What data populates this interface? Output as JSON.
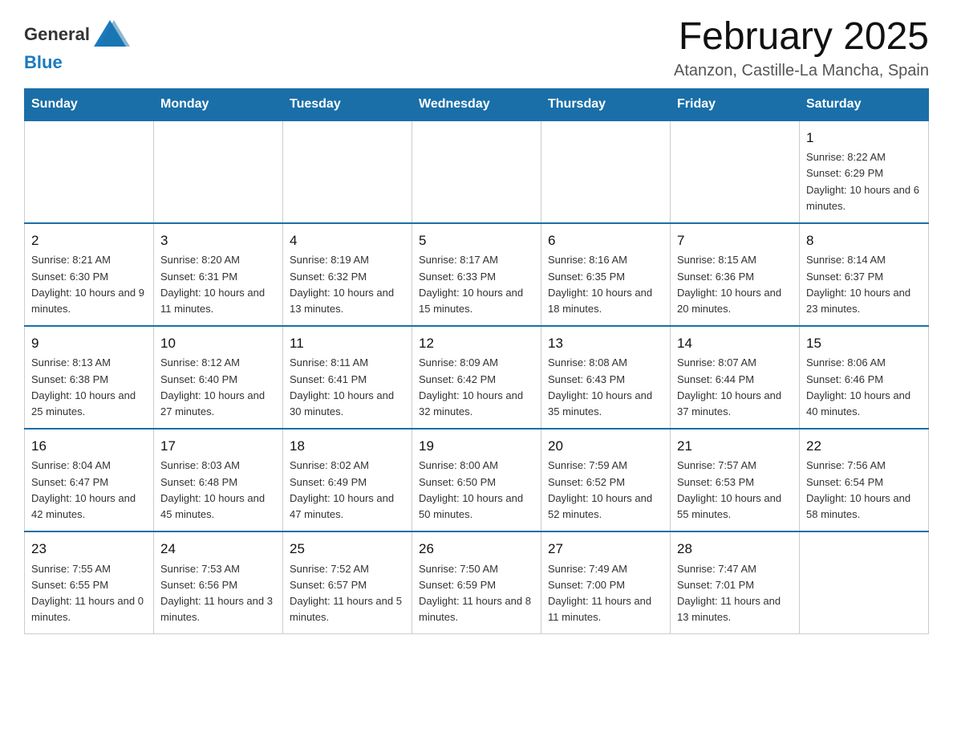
{
  "header": {
    "logo_general": "General",
    "logo_blue": "Blue",
    "month_title": "February 2025",
    "location": "Atanzon, Castille-La Mancha, Spain"
  },
  "weekdays": [
    "Sunday",
    "Monday",
    "Tuesday",
    "Wednesday",
    "Thursday",
    "Friday",
    "Saturday"
  ],
  "weeks": [
    [
      {
        "day": "",
        "info": ""
      },
      {
        "day": "",
        "info": ""
      },
      {
        "day": "",
        "info": ""
      },
      {
        "day": "",
        "info": ""
      },
      {
        "day": "",
        "info": ""
      },
      {
        "day": "",
        "info": ""
      },
      {
        "day": "1",
        "info": "Sunrise: 8:22 AM\nSunset: 6:29 PM\nDaylight: 10 hours and 6 minutes."
      }
    ],
    [
      {
        "day": "2",
        "info": "Sunrise: 8:21 AM\nSunset: 6:30 PM\nDaylight: 10 hours and 9 minutes."
      },
      {
        "day": "3",
        "info": "Sunrise: 8:20 AM\nSunset: 6:31 PM\nDaylight: 10 hours and 11 minutes."
      },
      {
        "day": "4",
        "info": "Sunrise: 8:19 AM\nSunset: 6:32 PM\nDaylight: 10 hours and 13 minutes."
      },
      {
        "day": "5",
        "info": "Sunrise: 8:17 AM\nSunset: 6:33 PM\nDaylight: 10 hours and 15 minutes."
      },
      {
        "day": "6",
        "info": "Sunrise: 8:16 AM\nSunset: 6:35 PM\nDaylight: 10 hours and 18 minutes."
      },
      {
        "day": "7",
        "info": "Sunrise: 8:15 AM\nSunset: 6:36 PM\nDaylight: 10 hours and 20 minutes."
      },
      {
        "day": "8",
        "info": "Sunrise: 8:14 AM\nSunset: 6:37 PM\nDaylight: 10 hours and 23 minutes."
      }
    ],
    [
      {
        "day": "9",
        "info": "Sunrise: 8:13 AM\nSunset: 6:38 PM\nDaylight: 10 hours and 25 minutes."
      },
      {
        "day": "10",
        "info": "Sunrise: 8:12 AM\nSunset: 6:40 PM\nDaylight: 10 hours and 27 minutes."
      },
      {
        "day": "11",
        "info": "Sunrise: 8:11 AM\nSunset: 6:41 PM\nDaylight: 10 hours and 30 minutes."
      },
      {
        "day": "12",
        "info": "Sunrise: 8:09 AM\nSunset: 6:42 PM\nDaylight: 10 hours and 32 minutes."
      },
      {
        "day": "13",
        "info": "Sunrise: 8:08 AM\nSunset: 6:43 PM\nDaylight: 10 hours and 35 minutes."
      },
      {
        "day": "14",
        "info": "Sunrise: 8:07 AM\nSunset: 6:44 PM\nDaylight: 10 hours and 37 minutes."
      },
      {
        "day": "15",
        "info": "Sunrise: 8:06 AM\nSunset: 6:46 PM\nDaylight: 10 hours and 40 minutes."
      }
    ],
    [
      {
        "day": "16",
        "info": "Sunrise: 8:04 AM\nSunset: 6:47 PM\nDaylight: 10 hours and 42 minutes."
      },
      {
        "day": "17",
        "info": "Sunrise: 8:03 AM\nSunset: 6:48 PM\nDaylight: 10 hours and 45 minutes."
      },
      {
        "day": "18",
        "info": "Sunrise: 8:02 AM\nSunset: 6:49 PM\nDaylight: 10 hours and 47 minutes."
      },
      {
        "day": "19",
        "info": "Sunrise: 8:00 AM\nSunset: 6:50 PM\nDaylight: 10 hours and 50 minutes."
      },
      {
        "day": "20",
        "info": "Sunrise: 7:59 AM\nSunset: 6:52 PM\nDaylight: 10 hours and 52 minutes."
      },
      {
        "day": "21",
        "info": "Sunrise: 7:57 AM\nSunset: 6:53 PM\nDaylight: 10 hours and 55 minutes."
      },
      {
        "day": "22",
        "info": "Sunrise: 7:56 AM\nSunset: 6:54 PM\nDaylight: 10 hours and 58 minutes."
      }
    ],
    [
      {
        "day": "23",
        "info": "Sunrise: 7:55 AM\nSunset: 6:55 PM\nDaylight: 11 hours and 0 minutes."
      },
      {
        "day": "24",
        "info": "Sunrise: 7:53 AM\nSunset: 6:56 PM\nDaylight: 11 hours and 3 minutes."
      },
      {
        "day": "25",
        "info": "Sunrise: 7:52 AM\nSunset: 6:57 PM\nDaylight: 11 hours and 5 minutes."
      },
      {
        "day": "26",
        "info": "Sunrise: 7:50 AM\nSunset: 6:59 PM\nDaylight: 11 hours and 8 minutes."
      },
      {
        "day": "27",
        "info": "Sunrise: 7:49 AM\nSunset: 7:00 PM\nDaylight: 11 hours and 11 minutes."
      },
      {
        "day": "28",
        "info": "Sunrise: 7:47 AM\nSunset: 7:01 PM\nDaylight: 11 hours and 13 minutes."
      },
      {
        "day": "",
        "info": ""
      }
    ]
  ]
}
